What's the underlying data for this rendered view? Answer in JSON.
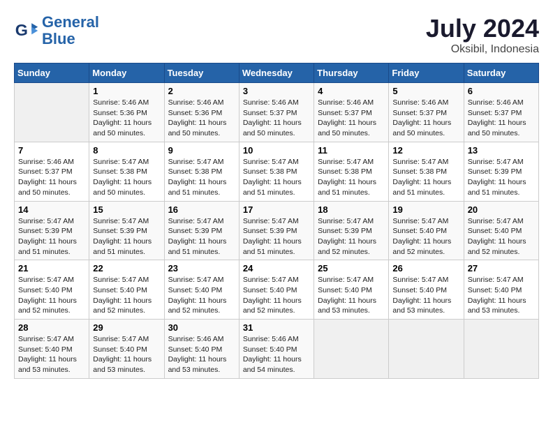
{
  "header": {
    "logo_line1": "General",
    "logo_line2": "Blue",
    "title": "July 2024",
    "subtitle": "Oksibil, Indonesia"
  },
  "days_of_week": [
    "Sunday",
    "Monday",
    "Tuesday",
    "Wednesday",
    "Thursday",
    "Friday",
    "Saturday"
  ],
  "weeks": [
    [
      {
        "day": "",
        "info": ""
      },
      {
        "day": "1",
        "info": "Sunrise: 5:46 AM\nSunset: 5:36 PM\nDaylight: 11 hours\nand 50 minutes."
      },
      {
        "day": "2",
        "info": "Sunrise: 5:46 AM\nSunset: 5:36 PM\nDaylight: 11 hours\nand 50 minutes."
      },
      {
        "day": "3",
        "info": "Sunrise: 5:46 AM\nSunset: 5:37 PM\nDaylight: 11 hours\nand 50 minutes."
      },
      {
        "day": "4",
        "info": "Sunrise: 5:46 AM\nSunset: 5:37 PM\nDaylight: 11 hours\nand 50 minutes."
      },
      {
        "day": "5",
        "info": "Sunrise: 5:46 AM\nSunset: 5:37 PM\nDaylight: 11 hours\nand 50 minutes."
      },
      {
        "day": "6",
        "info": "Sunrise: 5:46 AM\nSunset: 5:37 PM\nDaylight: 11 hours\nand 50 minutes."
      }
    ],
    [
      {
        "day": "7",
        "info": "Sunrise: 5:46 AM\nSunset: 5:37 PM\nDaylight: 11 hours\nand 50 minutes."
      },
      {
        "day": "8",
        "info": "Sunrise: 5:47 AM\nSunset: 5:38 PM\nDaylight: 11 hours\nand 50 minutes."
      },
      {
        "day": "9",
        "info": "Sunrise: 5:47 AM\nSunset: 5:38 PM\nDaylight: 11 hours\nand 51 minutes."
      },
      {
        "day": "10",
        "info": "Sunrise: 5:47 AM\nSunset: 5:38 PM\nDaylight: 11 hours\nand 51 minutes."
      },
      {
        "day": "11",
        "info": "Sunrise: 5:47 AM\nSunset: 5:38 PM\nDaylight: 11 hours\nand 51 minutes."
      },
      {
        "day": "12",
        "info": "Sunrise: 5:47 AM\nSunset: 5:38 PM\nDaylight: 11 hours\nand 51 minutes."
      },
      {
        "day": "13",
        "info": "Sunrise: 5:47 AM\nSunset: 5:39 PM\nDaylight: 11 hours\nand 51 minutes."
      }
    ],
    [
      {
        "day": "14",
        "info": "Sunrise: 5:47 AM\nSunset: 5:39 PM\nDaylight: 11 hours\nand 51 minutes."
      },
      {
        "day": "15",
        "info": "Sunrise: 5:47 AM\nSunset: 5:39 PM\nDaylight: 11 hours\nand 51 minutes."
      },
      {
        "day": "16",
        "info": "Sunrise: 5:47 AM\nSunset: 5:39 PM\nDaylight: 11 hours\nand 51 minutes."
      },
      {
        "day": "17",
        "info": "Sunrise: 5:47 AM\nSunset: 5:39 PM\nDaylight: 11 hours\nand 51 minutes."
      },
      {
        "day": "18",
        "info": "Sunrise: 5:47 AM\nSunset: 5:39 PM\nDaylight: 11 hours\nand 52 minutes."
      },
      {
        "day": "19",
        "info": "Sunrise: 5:47 AM\nSunset: 5:40 PM\nDaylight: 11 hours\nand 52 minutes."
      },
      {
        "day": "20",
        "info": "Sunrise: 5:47 AM\nSunset: 5:40 PM\nDaylight: 11 hours\nand 52 minutes."
      }
    ],
    [
      {
        "day": "21",
        "info": "Sunrise: 5:47 AM\nSunset: 5:40 PM\nDaylight: 11 hours\nand 52 minutes."
      },
      {
        "day": "22",
        "info": "Sunrise: 5:47 AM\nSunset: 5:40 PM\nDaylight: 11 hours\nand 52 minutes."
      },
      {
        "day": "23",
        "info": "Sunrise: 5:47 AM\nSunset: 5:40 PM\nDaylight: 11 hours\nand 52 minutes."
      },
      {
        "day": "24",
        "info": "Sunrise: 5:47 AM\nSunset: 5:40 PM\nDaylight: 11 hours\nand 52 minutes."
      },
      {
        "day": "25",
        "info": "Sunrise: 5:47 AM\nSunset: 5:40 PM\nDaylight: 11 hours\nand 53 minutes."
      },
      {
        "day": "26",
        "info": "Sunrise: 5:47 AM\nSunset: 5:40 PM\nDaylight: 11 hours\nand 53 minutes."
      },
      {
        "day": "27",
        "info": "Sunrise: 5:47 AM\nSunset: 5:40 PM\nDaylight: 11 hours\nand 53 minutes."
      }
    ],
    [
      {
        "day": "28",
        "info": "Sunrise: 5:47 AM\nSunset: 5:40 PM\nDaylight: 11 hours\nand 53 minutes."
      },
      {
        "day": "29",
        "info": "Sunrise: 5:47 AM\nSunset: 5:40 PM\nDaylight: 11 hours\nand 53 minutes."
      },
      {
        "day": "30",
        "info": "Sunrise: 5:46 AM\nSunset: 5:40 PM\nDaylight: 11 hours\nand 53 minutes."
      },
      {
        "day": "31",
        "info": "Sunrise: 5:46 AM\nSunset: 5:40 PM\nDaylight: 11 hours\nand 54 minutes."
      },
      {
        "day": "",
        "info": ""
      },
      {
        "day": "",
        "info": ""
      },
      {
        "day": "",
        "info": ""
      }
    ]
  ]
}
